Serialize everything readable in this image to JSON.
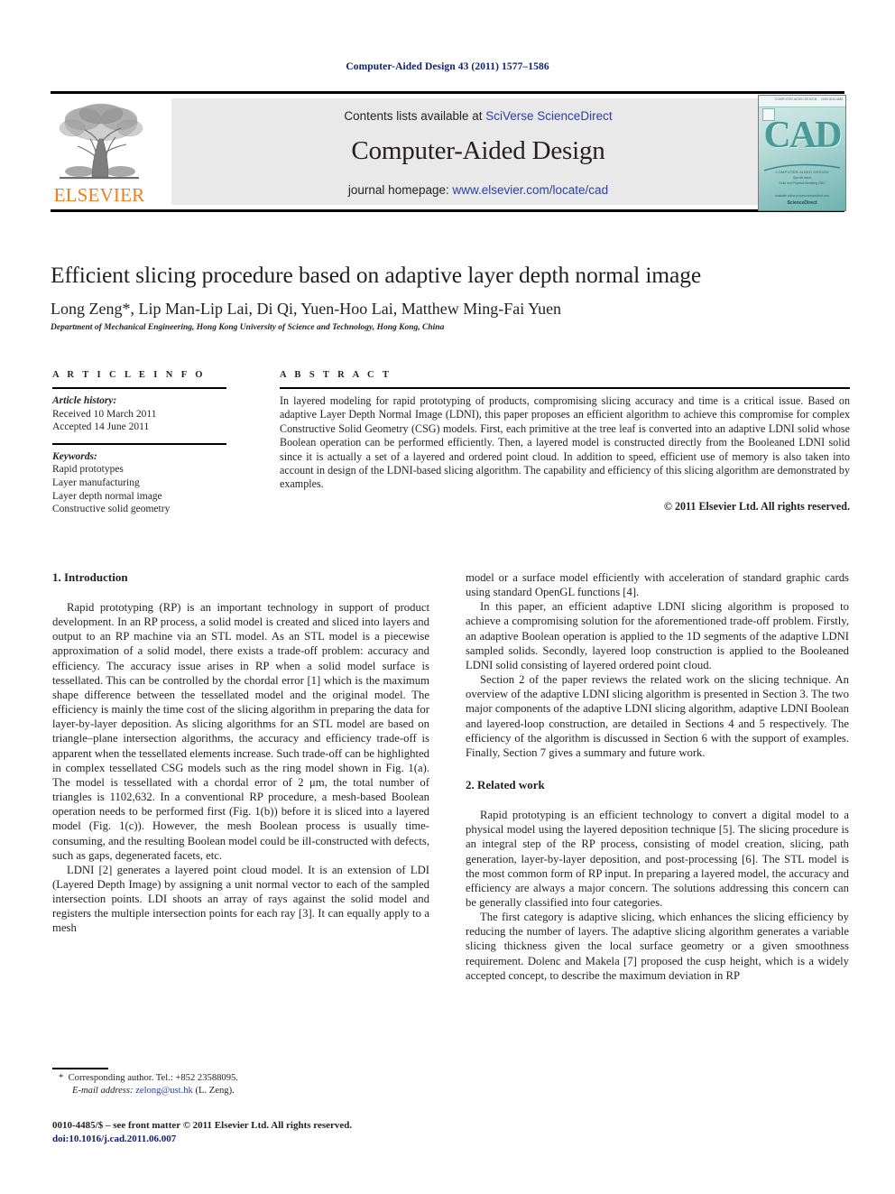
{
  "running_head": "Computer-Aided Design 43 (2011) 1577–1586",
  "masthead": {
    "publisher_name": "ELSEVIER",
    "contents_prefix": "Contents lists available at ",
    "contents_link": "SciVerse ScienceDirect",
    "journal_title": "Computer-Aided Design",
    "homepage_prefix": "journal homepage: ",
    "homepage_url": "www.elsevier.com/locate/cad",
    "cover": {
      "banner_left": "COMPUTER-AIDED DESIGN",
      "banner_right": "ISSN 0010-4485",
      "logo_text": "CAD",
      "sub1": "COMPUTER-AIDED DESIGN",
      "sub2": "Special issue",
      "sub3": "Solid and Physical Modeling 2010",
      "footer1": "Available online at www.sciencedirect.com",
      "footer2": "ScienceDirect"
    }
  },
  "article": {
    "title": "Efficient slicing procedure based on adaptive layer depth normal image",
    "authors": "Long Zeng*, Lip Man-Lip Lai, Di Qi, Yuen-Hoo Lai, Matthew Ming-Fai Yuen",
    "affiliation": "Department of Mechanical Engineering, Hong Kong University of Science and Technology, Hong Kong, China"
  },
  "article_info": {
    "heading": "A R T I C L E    I N F O",
    "history_label": "Article history:",
    "received": "Received 10 March 2011",
    "accepted": "Accepted 14 June 2011",
    "keywords_label": "Keywords:",
    "keywords": [
      "Rapid prototypes",
      "Layer manufacturing",
      "Layer depth normal image",
      "Constructive solid geometry"
    ]
  },
  "abstract": {
    "heading": "A B S T R A C T",
    "text": "In layered modeling for rapid prototyping of products, compromising slicing accuracy and time is a critical issue. Based on adaptive Layer Depth Normal Image (LDNI), this paper proposes an efficient algorithm to achieve this compromise for complex Constructive Solid Geometry (CSG) models. First, each primitive at the tree leaf is converted into an adaptive LDNI solid whose Boolean operation can be performed efficiently. Then, a layered model is constructed directly from the Booleaned LDNI solid since it is actually a set of a layered and ordered point cloud. In addition to speed, efficient use of memory is also taken into account in design of the LDNI-based slicing algorithm. The capability and efficiency of this slicing algorithm are demonstrated by examples.",
    "rights": "© 2011 Elsevier Ltd. All rights reserved."
  },
  "body": {
    "section1_heading": "1.  Introduction",
    "section2_heading": "2.  Related work",
    "left_paragraphs": [
      "Rapid prototyping (RP) is an important technology in support of product development. In an RP process, a solid model is created and sliced into layers and output to an RP machine via an STL model. As an STL model is a piecewise approximation of a solid model, there exists a trade-off problem: accuracy and efficiency. The accuracy issue arises in RP when a solid model surface is tessellated. This can be controlled by the chordal error [1] which is the maximum shape difference between the tessellated model and the original model. The efficiency is mainly the time cost of the slicing algorithm in preparing the data for layer-by-layer deposition. As slicing algorithms for an STL model are based on triangle–plane intersection algorithms, the accuracy and efficiency trade-off is apparent when the tessellated elements increase. Such trade-off can be highlighted in complex tessellated CSG models such as the ring model shown in Fig. 1(a). The model is tessellated with a chordal error of 2 μm, the total number of triangles is 1102,632. In a conventional RP procedure, a mesh-based Boolean operation needs to be performed first (Fig. 1(b)) before it is sliced into a layered model (Fig. 1(c)). However, the mesh Boolean process is usually time-consuming, and the resulting Boolean model could be ill-constructed with defects, such as gaps, degenerated facets, etc.",
      "LDNI [2] generates a layered point cloud model. It is an extension of LDI (Layered Depth Image) by assigning a unit normal vector to each of the sampled intersection points. LDI shoots an array of rays against the solid model and registers the multiple intersection points for each ray [3]. It can equally apply to a mesh"
    ],
    "right_paragraphs": [
      "model or a surface model efficiently with acceleration of standard graphic cards using standard OpenGL functions [4].",
      "In this paper, an efficient adaptive LDNI slicing algorithm is proposed to achieve a compromising solution for the aforementioned trade-off problem. Firstly, an adaptive Boolean operation is applied to the 1D segments of the adaptive LDNI sampled solids. Secondly, layered loop construction is applied to the Booleaned LDNI solid consisting of layered ordered point cloud.",
      "Section 2 of the paper reviews the related work on the slicing technique. An overview of the adaptive LDNI slicing algorithm is presented in Section 3. The two major components of the adaptive LDNI slicing algorithm, adaptive LDNI Boolean and layered-loop construction, are detailed in Sections 4 and 5 respectively. The efficiency of the algorithm is discussed in Section 6 with the support of examples. Finally, Section 7 gives a summary and future work.",
      "Rapid prototyping is an efficient technology to convert a digital model to a physical model using the layered deposition technique [5]. The slicing procedure is an integral step of the RP process, consisting of model creation, slicing, path generation, layer-by-layer deposition, and post-processing [6]. The STL model is the most common form of RP input. In preparing a layered model, the accuracy and efficiency are always a major concern. The solutions addressing this concern can be generally classified into four categories.",
      "The first category is adaptive slicing, which enhances the slicing efficiency by reducing the number of layers. The adaptive slicing algorithm generates a variable slicing thickness given the local surface geometry or a given smoothness requirement. Dolenc and Makela [7] proposed the cusp height, which is a widely accepted concept, to describe the maximum deviation in RP"
    ]
  },
  "footnote": {
    "marker": "*",
    "corresponding": "Corresponding author. Tel.: +852 23588095.",
    "email_label": "E-mail address:",
    "email": "zelong@ust.hk",
    "email_suffix": "(L. Zeng)."
  },
  "colophon": {
    "line1": "0010-4485/$ – see front matter © 2011 Elsevier Ltd. All rights reserved.",
    "line2": "doi:10.1016/j.cad.2011.06.007"
  },
  "colors": {
    "link_blue": "#2b3fa0",
    "running_head_blue": "#11206b",
    "elsevier_orange": "#ef7d1a",
    "band_gray": "#e9e9e9",
    "cover_teal": "#4a9b98"
  }
}
